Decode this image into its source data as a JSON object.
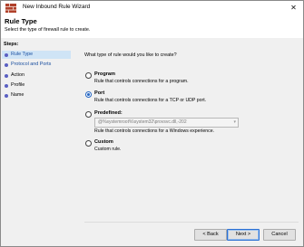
{
  "window": {
    "title": "New Inbound Rule Wizard",
    "close_glyph": "✕"
  },
  "header": {
    "title": "Rule Type",
    "subtitle": "Select the type of firewall rule to create."
  },
  "steps": {
    "label": "Steps:",
    "items": [
      {
        "label": "Rule Type",
        "active": true
      },
      {
        "label": "Protocol and Ports",
        "active": false
      },
      {
        "label": "Action",
        "active": false
      },
      {
        "label": "Profile",
        "active": false
      },
      {
        "label": "Name",
        "active": false
      }
    ]
  },
  "main": {
    "question": "What type of rule would you like to create?",
    "options": [
      {
        "label": "Program",
        "description": "Rule that controls connections for a program.",
        "selected": false
      },
      {
        "label": "Port",
        "description": "Rule that controls connections for a TCP or UDP port.",
        "selected": true
      },
      {
        "label": "Predefined:",
        "select_value": "@%systemroot%\\system32\\provsvc.dll,-202",
        "description": "Rule that controls connections for a Windows experience.",
        "selected": false
      },
      {
        "label": "Custom",
        "description": "Custom rule.",
        "selected": false
      }
    ]
  },
  "buttons": {
    "back": "< Back",
    "next": "Next >",
    "cancel": "Cancel"
  },
  "colors": {
    "accent": "#2264c2",
    "step_active_bg": "#cfe4f6",
    "step_dot": "#5a5fc2"
  },
  "icons": {
    "title": "firewall-icon",
    "close": "close-icon",
    "dropdown": "chevron-down-icon"
  }
}
